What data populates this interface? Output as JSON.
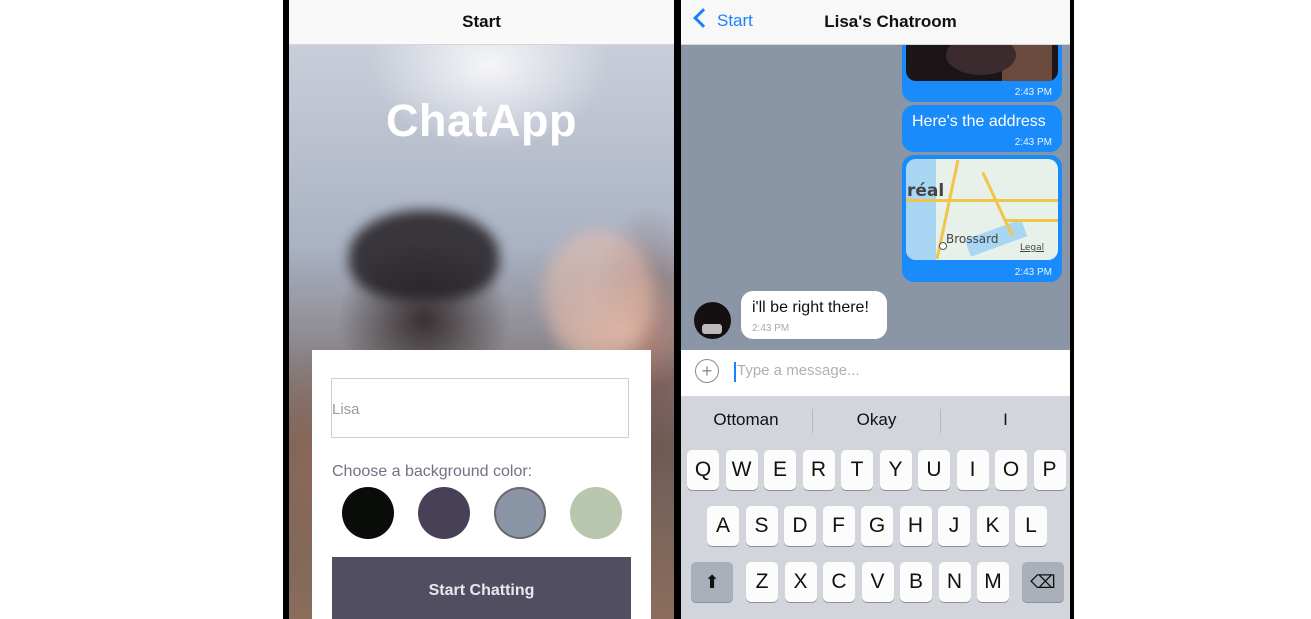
{
  "left": {
    "nav_title": "Start",
    "app_title": "ChatApp",
    "name_input": {
      "placeholder": "Lisa"
    },
    "bg_color_label": "Choose a background color:",
    "colors": [
      "#090C08",
      "#474056",
      "#8A95A5",
      "#B9C6AE"
    ],
    "start_button": "Start Chatting"
  },
  "right": {
    "back_label": "Start",
    "nav_title": "Lisa's Chatroom",
    "messages": [
      {
        "kind": "image",
        "side": "right",
        "time": "2:43 PM"
      },
      {
        "kind": "text",
        "side": "right",
        "text": "Here's the address",
        "time": "2:43 PM"
      },
      {
        "kind": "map",
        "side": "right",
        "time": "2:43 PM",
        "map_labels": {
          "city": "réal",
          "suburb": "Brossard",
          "legal": "Legal"
        }
      },
      {
        "kind": "text",
        "side": "left",
        "text": "i'll be right there!",
        "time": "2:43 PM"
      }
    ],
    "composer_placeholder": "Type a message...",
    "suggestions": [
      "Ottoman",
      "Okay",
      "I"
    ],
    "keys": {
      "row1": [
        "Q",
        "W",
        "E",
        "R",
        "T",
        "Y",
        "U",
        "I",
        "O",
        "P"
      ],
      "row2": [
        "A",
        "S",
        "D",
        "F",
        "G",
        "H",
        "J",
        "K",
        "L"
      ],
      "row3": [
        "Z",
        "X",
        "C",
        "V",
        "B",
        "N",
        "M"
      ]
    },
    "icons": {
      "shift": "shift-icon",
      "delete": "backspace-icon",
      "add": "plus-icon",
      "back": "chevron-left-icon"
    }
  }
}
